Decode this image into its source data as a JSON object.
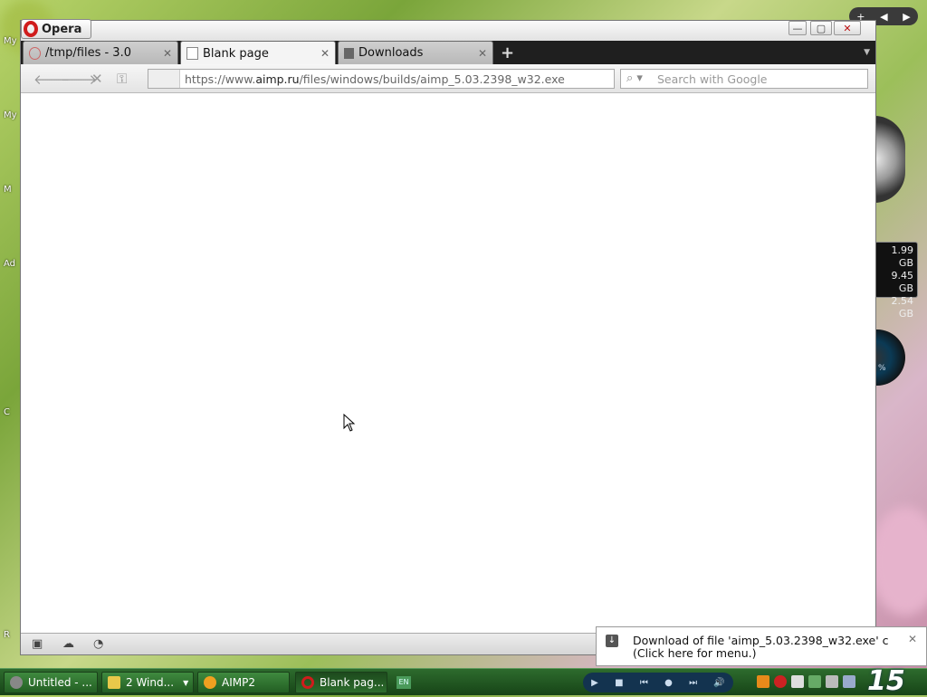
{
  "desktop": {
    "labels": [
      "My",
      "My",
      "M",
      "Ad",
      "C",
      "R"
    ],
    "drive_gadget": [
      "1.99 GB",
      "9.45 GB",
      "2.54 GB"
    ],
    "meter_label": "%"
  },
  "window": {
    "title": "Opera",
    "tabs": [
      {
        "label": "/tmp/files - 3.0"
      },
      {
        "label": "Blank page"
      },
      {
        "label": "Downloads"
      }
    ],
    "address": {
      "url_prefix": "https://www.",
      "url_domain": "aimp.ru",
      "url_path": "/files/windows/builds/aimp_5.03.2398_w32.exe"
    },
    "search": {
      "placeholder": "Search with Google"
    }
  },
  "notification": {
    "line1": "Download of file 'aimp_5.03.2398_w32.exe' c",
    "line2": "(Click here for menu.)"
  },
  "taskbar": {
    "items": [
      {
        "label": "Untitled - ..."
      },
      {
        "label": "2 Wind..."
      },
      {
        "label": "AIMP2"
      },
      {
        "label": "Blank pag..."
      }
    ],
    "lang": "EN",
    "clock": "15"
  }
}
